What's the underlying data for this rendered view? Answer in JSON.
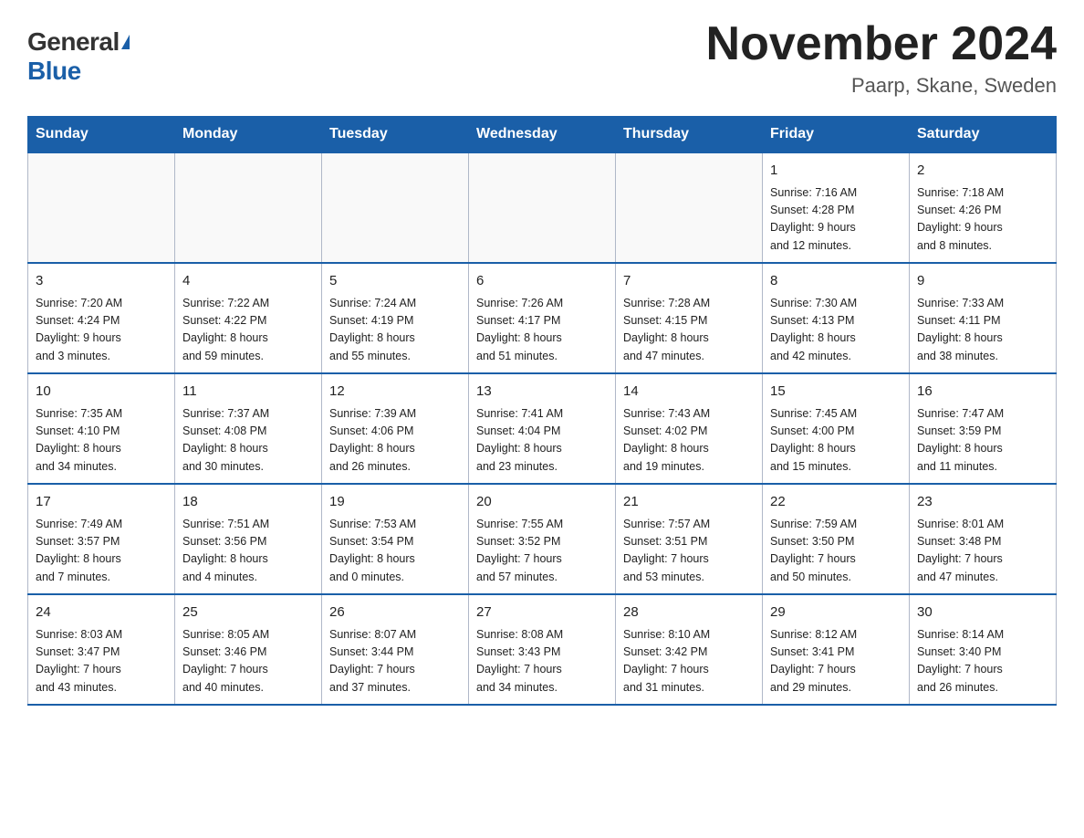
{
  "header": {
    "logo_general": "General",
    "logo_blue": "Blue",
    "title": "November 2024",
    "location": "Paarp, Skane, Sweden"
  },
  "days_of_week": [
    "Sunday",
    "Monday",
    "Tuesday",
    "Wednesday",
    "Thursday",
    "Friday",
    "Saturday"
  ],
  "weeks": [
    [
      {
        "day": "",
        "info": ""
      },
      {
        "day": "",
        "info": ""
      },
      {
        "day": "",
        "info": ""
      },
      {
        "day": "",
        "info": ""
      },
      {
        "day": "",
        "info": ""
      },
      {
        "day": "1",
        "info": "Sunrise: 7:16 AM\nSunset: 4:28 PM\nDaylight: 9 hours\nand 12 minutes."
      },
      {
        "day": "2",
        "info": "Sunrise: 7:18 AM\nSunset: 4:26 PM\nDaylight: 9 hours\nand 8 minutes."
      }
    ],
    [
      {
        "day": "3",
        "info": "Sunrise: 7:20 AM\nSunset: 4:24 PM\nDaylight: 9 hours\nand 3 minutes."
      },
      {
        "day": "4",
        "info": "Sunrise: 7:22 AM\nSunset: 4:22 PM\nDaylight: 8 hours\nand 59 minutes."
      },
      {
        "day": "5",
        "info": "Sunrise: 7:24 AM\nSunset: 4:19 PM\nDaylight: 8 hours\nand 55 minutes."
      },
      {
        "day": "6",
        "info": "Sunrise: 7:26 AM\nSunset: 4:17 PM\nDaylight: 8 hours\nand 51 minutes."
      },
      {
        "day": "7",
        "info": "Sunrise: 7:28 AM\nSunset: 4:15 PM\nDaylight: 8 hours\nand 47 minutes."
      },
      {
        "day": "8",
        "info": "Sunrise: 7:30 AM\nSunset: 4:13 PM\nDaylight: 8 hours\nand 42 minutes."
      },
      {
        "day": "9",
        "info": "Sunrise: 7:33 AM\nSunset: 4:11 PM\nDaylight: 8 hours\nand 38 minutes."
      }
    ],
    [
      {
        "day": "10",
        "info": "Sunrise: 7:35 AM\nSunset: 4:10 PM\nDaylight: 8 hours\nand 34 minutes."
      },
      {
        "day": "11",
        "info": "Sunrise: 7:37 AM\nSunset: 4:08 PM\nDaylight: 8 hours\nand 30 minutes."
      },
      {
        "day": "12",
        "info": "Sunrise: 7:39 AM\nSunset: 4:06 PM\nDaylight: 8 hours\nand 26 minutes."
      },
      {
        "day": "13",
        "info": "Sunrise: 7:41 AM\nSunset: 4:04 PM\nDaylight: 8 hours\nand 23 minutes."
      },
      {
        "day": "14",
        "info": "Sunrise: 7:43 AM\nSunset: 4:02 PM\nDaylight: 8 hours\nand 19 minutes."
      },
      {
        "day": "15",
        "info": "Sunrise: 7:45 AM\nSunset: 4:00 PM\nDaylight: 8 hours\nand 15 minutes."
      },
      {
        "day": "16",
        "info": "Sunrise: 7:47 AM\nSunset: 3:59 PM\nDaylight: 8 hours\nand 11 minutes."
      }
    ],
    [
      {
        "day": "17",
        "info": "Sunrise: 7:49 AM\nSunset: 3:57 PM\nDaylight: 8 hours\nand 7 minutes."
      },
      {
        "day": "18",
        "info": "Sunrise: 7:51 AM\nSunset: 3:56 PM\nDaylight: 8 hours\nand 4 minutes."
      },
      {
        "day": "19",
        "info": "Sunrise: 7:53 AM\nSunset: 3:54 PM\nDaylight: 8 hours\nand 0 minutes."
      },
      {
        "day": "20",
        "info": "Sunrise: 7:55 AM\nSunset: 3:52 PM\nDaylight: 7 hours\nand 57 minutes."
      },
      {
        "day": "21",
        "info": "Sunrise: 7:57 AM\nSunset: 3:51 PM\nDaylight: 7 hours\nand 53 minutes."
      },
      {
        "day": "22",
        "info": "Sunrise: 7:59 AM\nSunset: 3:50 PM\nDaylight: 7 hours\nand 50 minutes."
      },
      {
        "day": "23",
        "info": "Sunrise: 8:01 AM\nSunset: 3:48 PM\nDaylight: 7 hours\nand 47 minutes."
      }
    ],
    [
      {
        "day": "24",
        "info": "Sunrise: 8:03 AM\nSunset: 3:47 PM\nDaylight: 7 hours\nand 43 minutes."
      },
      {
        "day": "25",
        "info": "Sunrise: 8:05 AM\nSunset: 3:46 PM\nDaylight: 7 hours\nand 40 minutes."
      },
      {
        "day": "26",
        "info": "Sunrise: 8:07 AM\nSunset: 3:44 PM\nDaylight: 7 hours\nand 37 minutes."
      },
      {
        "day": "27",
        "info": "Sunrise: 8:08 AM\nSunset: 3:43 PM\nDaylight: 7 hours\nand 34 minutes."
      },
      {
        "day": "28",
        "info": "Sunrise: 8:10 AM\nSunset: 3:42 PM\nDaylight: 7 hours\nand 31 minutes."
      },
      {
        "day": "29",
        "info": "Sunrise: 8:12 AM\nSunset: 3:41 PM\nDaylight: 7 hours\nand 29 minutes."
      },
      {
        "day": "30",
        "info": "Sunrise: 8:14 AM\nSunset: 3:40 PM\nDaylight: 7 hours\nand 26 minutes."
      }
    ]
  ]
}
